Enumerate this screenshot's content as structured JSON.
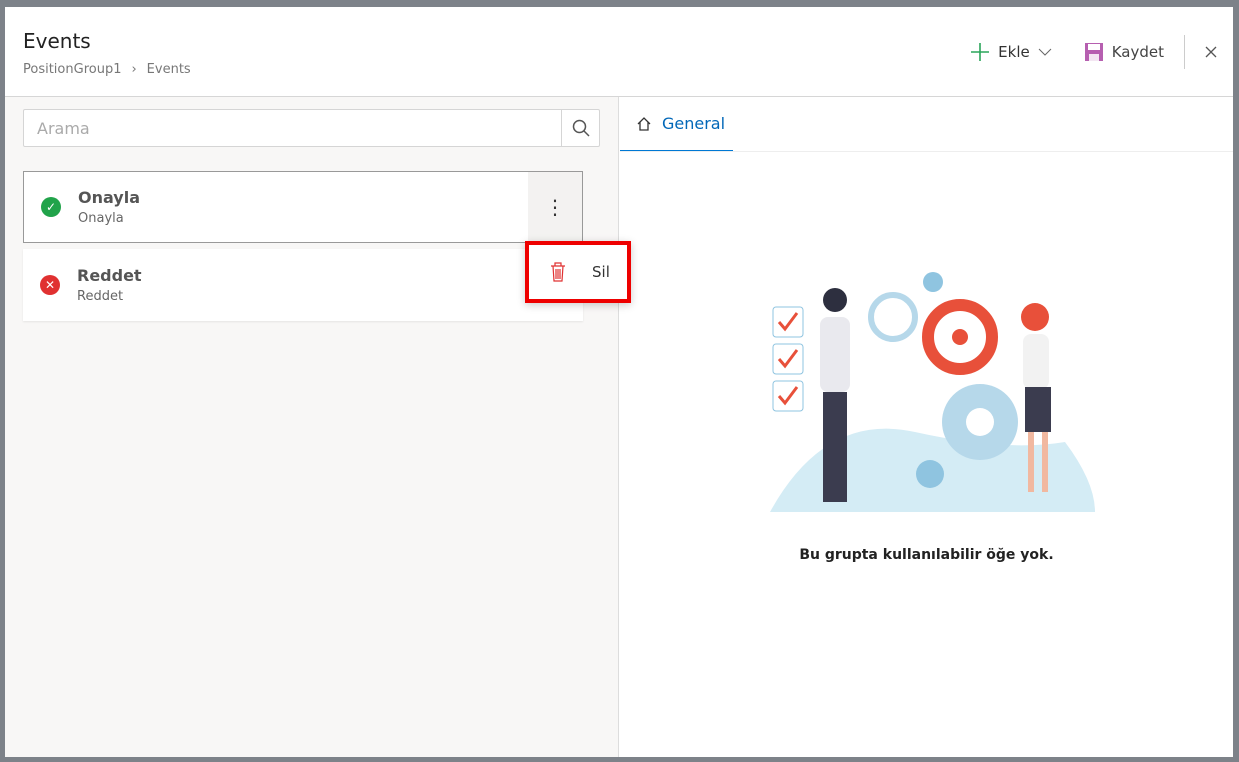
{
  "header": {
    "title": "Events",
    "breadcrumb": [
      "PositionGroup1",
      "Events"
    ]
  },
  "toolbar": {
    "add_label": "Ekle",
    "save_label": "Kaydet"
  },
  "search": {
    "placeholder": "Arama",
    "value": ""
  },
  "items": [
    {
      "title": "Onayla",
      "subtitle": "Onayla",
      "status": "approved",
      "color": "#21a34a"
    },
    {
      "title": "Reddet",
      "subtitle": "Reddet",
      "status": "rejected",
      "color": "#e03131"
    }
  ],
  "context_menu": {
    "delete_label": "Sil"
  },
  "tabs": [
    {
      "label": "General",
      "active": true
    }
  ],
  "empty_state": {
    "message": "Bu grupta kullanılabilir öğe yok."
  }
}
